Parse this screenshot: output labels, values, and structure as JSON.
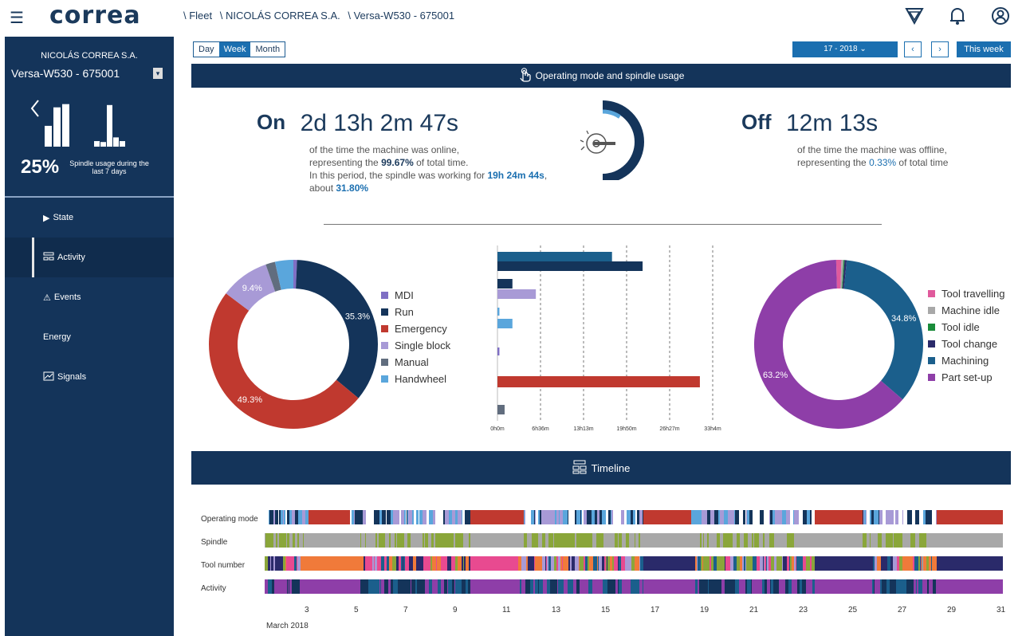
{
  "header": {
    "logo": "correa",
    "breadcrumb": [
      "\\ Fleet",
      "\\ NICOLÁS CORREA S.A.",
      "\\ Versa-W530 - 675001"
    ]
  },
  "sidebar": {
    "company": "NICOLÁS CORREA S.A.",
    "machine": "Versa-W530 - 675001",
    "usage_pct": "25%",
    "usage_text": "Spindle usage during the last 7 days",
    "usage_bars_a": [
      0.45,
      0.85,
      0.92
    ],
    "usage_bars_b": [
      0.12,
      0.1,
      0.9,
      0.2,
      0.12
    ],
    "nav": [
      {
        "label": "State",
        "icon": "play-icon"
      },
      {
        "label": "Activity",
        "icon": "activity-icon"
      },
      {
        "label": "Events",
        "icon": "warning-icon"
      },
      {
        "label": "Energy",
        "icon": ""
      },
      {
        "label": "Signals",
        "icon": "chart-icon"
      }
    ]
  },
  "toolbar": {
    "periods": [
      "Day",
      "Week",
      "Month"
    ],
    "selected_period": "Week",
    "date": "17 - 2018 ⌄",
    "prev": "‹",
    "next": "›",
    "this_week": "This week"
  },
  "section1": {
    "title": "Operating mode and spindle usage",
    "on_label": "On",
    "on_time": "2d 13h 2m 47s",
    "on_desc_1": "of the time the machine was online,",
    "on_desc_2a": "representing the ",
    "on_desc_2b": "99.67%",
    "on_desc_2c": " of total time.",
    "on_desc_3a": "In this period, the spindle was working for ",
    "on_desc_3b": "19h 24m 44s",
    "on_desc_3c": ", about ",
    "on_desc_3d": "31.80%",
    "off_label": "Off",
    "off_time": "12m 13s",
    "off_desc_1": "of the time the machine was offline,",
    "off_desc_2a": "representing the ",
    "off_desc_2b": "0.33%",
    "off_desc_2c": " of total time",
    "gauge_fraction": 0.318
  },
  "colors": {
    "mdi": "#7f6fc4",
    "run": "#14345a",
    "emergency": "#c0392f",
    "single_block": "#a89ad6",
    "manual": "#616d7e",
    "handwheel": "#5aa6dc",
    "tool_travelling": "#e05a9c",
    "machine_idle": "#a8a8a8",
    "tool_idle": "#1a8c3a",
    "tool_change": "#2a2a6a",
    "machining": "#1b5f8c",
    "part_setup": "#8e3ea8",
    "spindle_green": "#8aa63a",
    "tool_orange": "#f07a3a",
    "tool_pink": "#e84a90"
  },
  "chart_data": [
    {
      "type": "pie",
      "categories": [
        "MDI",
        "Run",
        "Emergency",
        "Single block",
        "Manual",
        "Handwheel"
      ],
      "values": [
        0.7,
        35.3,
        49.3,
        9.4,
        1.8,
        3.5
      ],
      "labels_shown": [
        "9.4%",
        "35.3%",
        "49.3%"
      ]
    },
    {
      "type": "bar",
      "orientation": "horizontal",
      "x_ticks": [
        "0h0m",
        "6h36m",
        "13h13m",
        "19h50m",
        "26h27m",
        "33h4m"
      ],
      "bars": [
        {
          "series": "Machining",
          "value_h": 17.6
        },
        {
          "series": "Run",
          "value_h": 22.3
        },
        {
          "series": "Run",
          "value_h": 2.3
        },
        {
          "series": "Single block",
          "value_h": 5.9
        },
        {
          "series": "Handwheel",
          "value_h": 0.3
        },
        {
          "series": "Handwheel",
          "value_h": 2.3
        },
        {
          "series": "MDI",
          "value_h": 0.3
        },
        {
          "series": "Emergency",
          "value_h": 31.1
        },
        {
          "series": "Manual",
          "value_h": 1.1
        }
      ]
    },
    {
      "type": "pie",
      "categories": [
        "Tool travelling",
        "Machine idle",
        "Tool idle",
        "Tool change",
        "Machining",
        "Part set-up"
      ],
      "values": [
        1.0,
        0.4,
        0.2,
        0.4,
        34.8,
        63.2
      ],
      "labels_shown": [
        "34.8%",
        "63.2%"
      ]
    }
  ],
  "timeline": {
    "title": "Timeline",
    "rows": [
      "Operating mode",
      "Spindle",
      "Tool number",
      "Activity"
    ],
    "x_ticks": [
      "3",
      "5",
      "7",
      "9",
      "11",
      "13",
      "15",
      "17",
      "19",
      "21",
      "23",
      "25",
      "27",
      "29",
      "31"
    ],
    "month": "March 2018"
  }
}
